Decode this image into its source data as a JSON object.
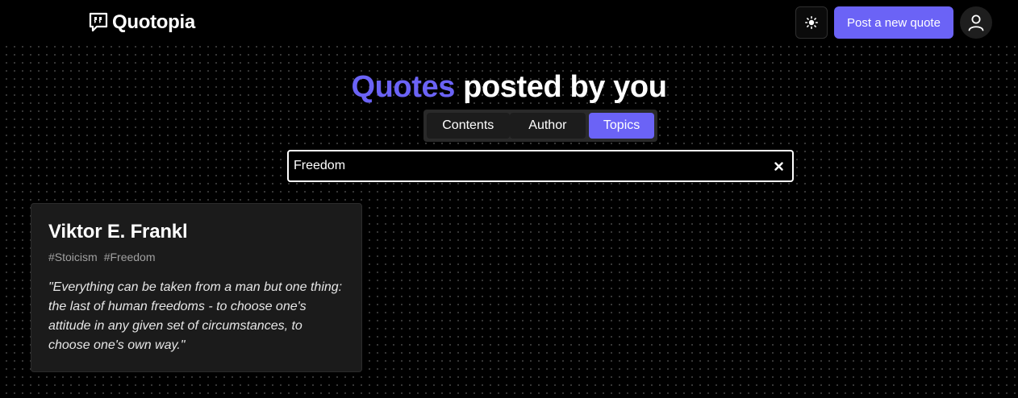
{
  "header": {
    "brand_name": "Quotopia",
    "brand_icon": "quote-bubble-icon",
    "theme_icon": "sun-icon",
    "post_button_label": "Post a new quote",
    "avatar_icon": "user-icon"
  },
  "title": {
    "accent": "Quotes",
    "rest": "posted by you"
  },
  "tabs": [
    {
      "label": "Contents",
      "active": false
    },
    {
      "label": "Author",
      "active": false
    },
    {
      "label": "Topics",
      "active": true
    }
  ],
  "search": {
    "value": "Freedom",
    "clear_icon": "close-icon"
  },
  "quotes": [
    {
      "author": "Viktor E. Frankl",
      "tags": [
        "#Stoicism",
        "#Freedom"
      ],
      "text": "\"Everything can be taken from a man but one thing: the last of human freedoms - to choose one's attitude in any given set of circumstances, to choose one's own way.\""
    }
  ],
  "colors": {
    "accent": "#6b63f6",
    "background": "#000000",
    "card": "#1b1b1b"
  }
}
